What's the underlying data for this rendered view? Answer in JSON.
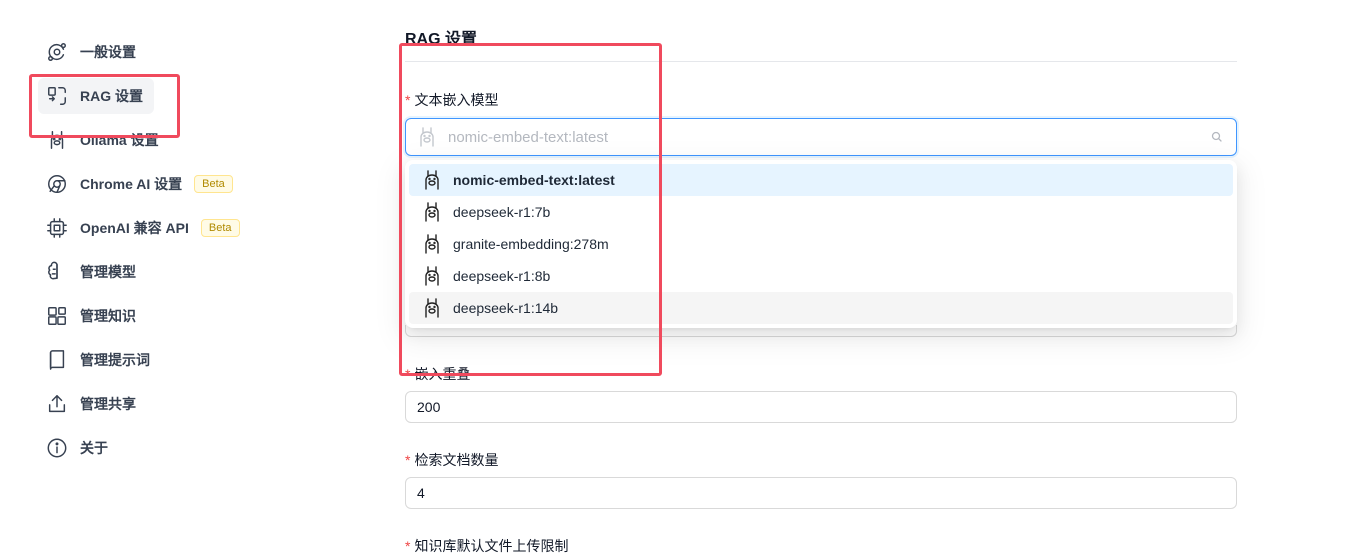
{
  "sidebar": {
    "items": [
      {
        "label": "一般设置",
        "icon": "orbit-icon"
      },
      {
        "label": "RAG 设置",
        "icon": "scan-icon"
      },
      {
        "label": "Ollama 设置",
        "icon": "llama-icon"
      },
      {
        "label": "Chrome AI 设置",
        "icon": "chrome-icon",
        "badge": "Beta"
      },
      {
        "label": "OpenAI 兼容 API",
        "icon": "chip-icon",
        "badge": "Beta"
      },
      {
        "label": "管理模型",
        "icon": "brain-icon"
      },
      {
        "label": "管理知识",
        "icon": "blocks-icon"
      },
      {
        "label": "管理提示词",
        "icon": "book-icon"
      },
      {
        "label": "管理共享",
        "icon": "share-icon"
      },
      {
        "label": "关于",
        "icon": "info-icon"
      }
    ],
    "active_index": 1
  },
  "main": {
    "title": "RAG 设置",
    "embedding_model": {
      "label": "文本嵌入模型",
      "placeholder": "nomic-embed-text:latest",
      "options": [
        "nomic-embed-text:latest",
        "deepseek-r1:7b",
        "granite-embedding:278m",
        "deepseek-r1:8b",
        "deepseek-r1:14b"
      ],
      "selected_index": 0,
      "hover_index": 4
    },
    "chunk_overlap": {
      "label": "嵌入重叠",
      "value": "200"
    },
    "retrieved_docs": {
      "label": "检索文档数量",
      "value": "4"
    },
    "upload_limit": {
      "label": "知识库默认文件上传限制"
    }
  },
  "colors": {
    "highlight": "#f04a5d",
    "focus_border": "#4096ff",
    "selected_bg": "#e6f4ff",
    "required": "#ef4444",
    "beta_text": "#b08a00"
  }
}
